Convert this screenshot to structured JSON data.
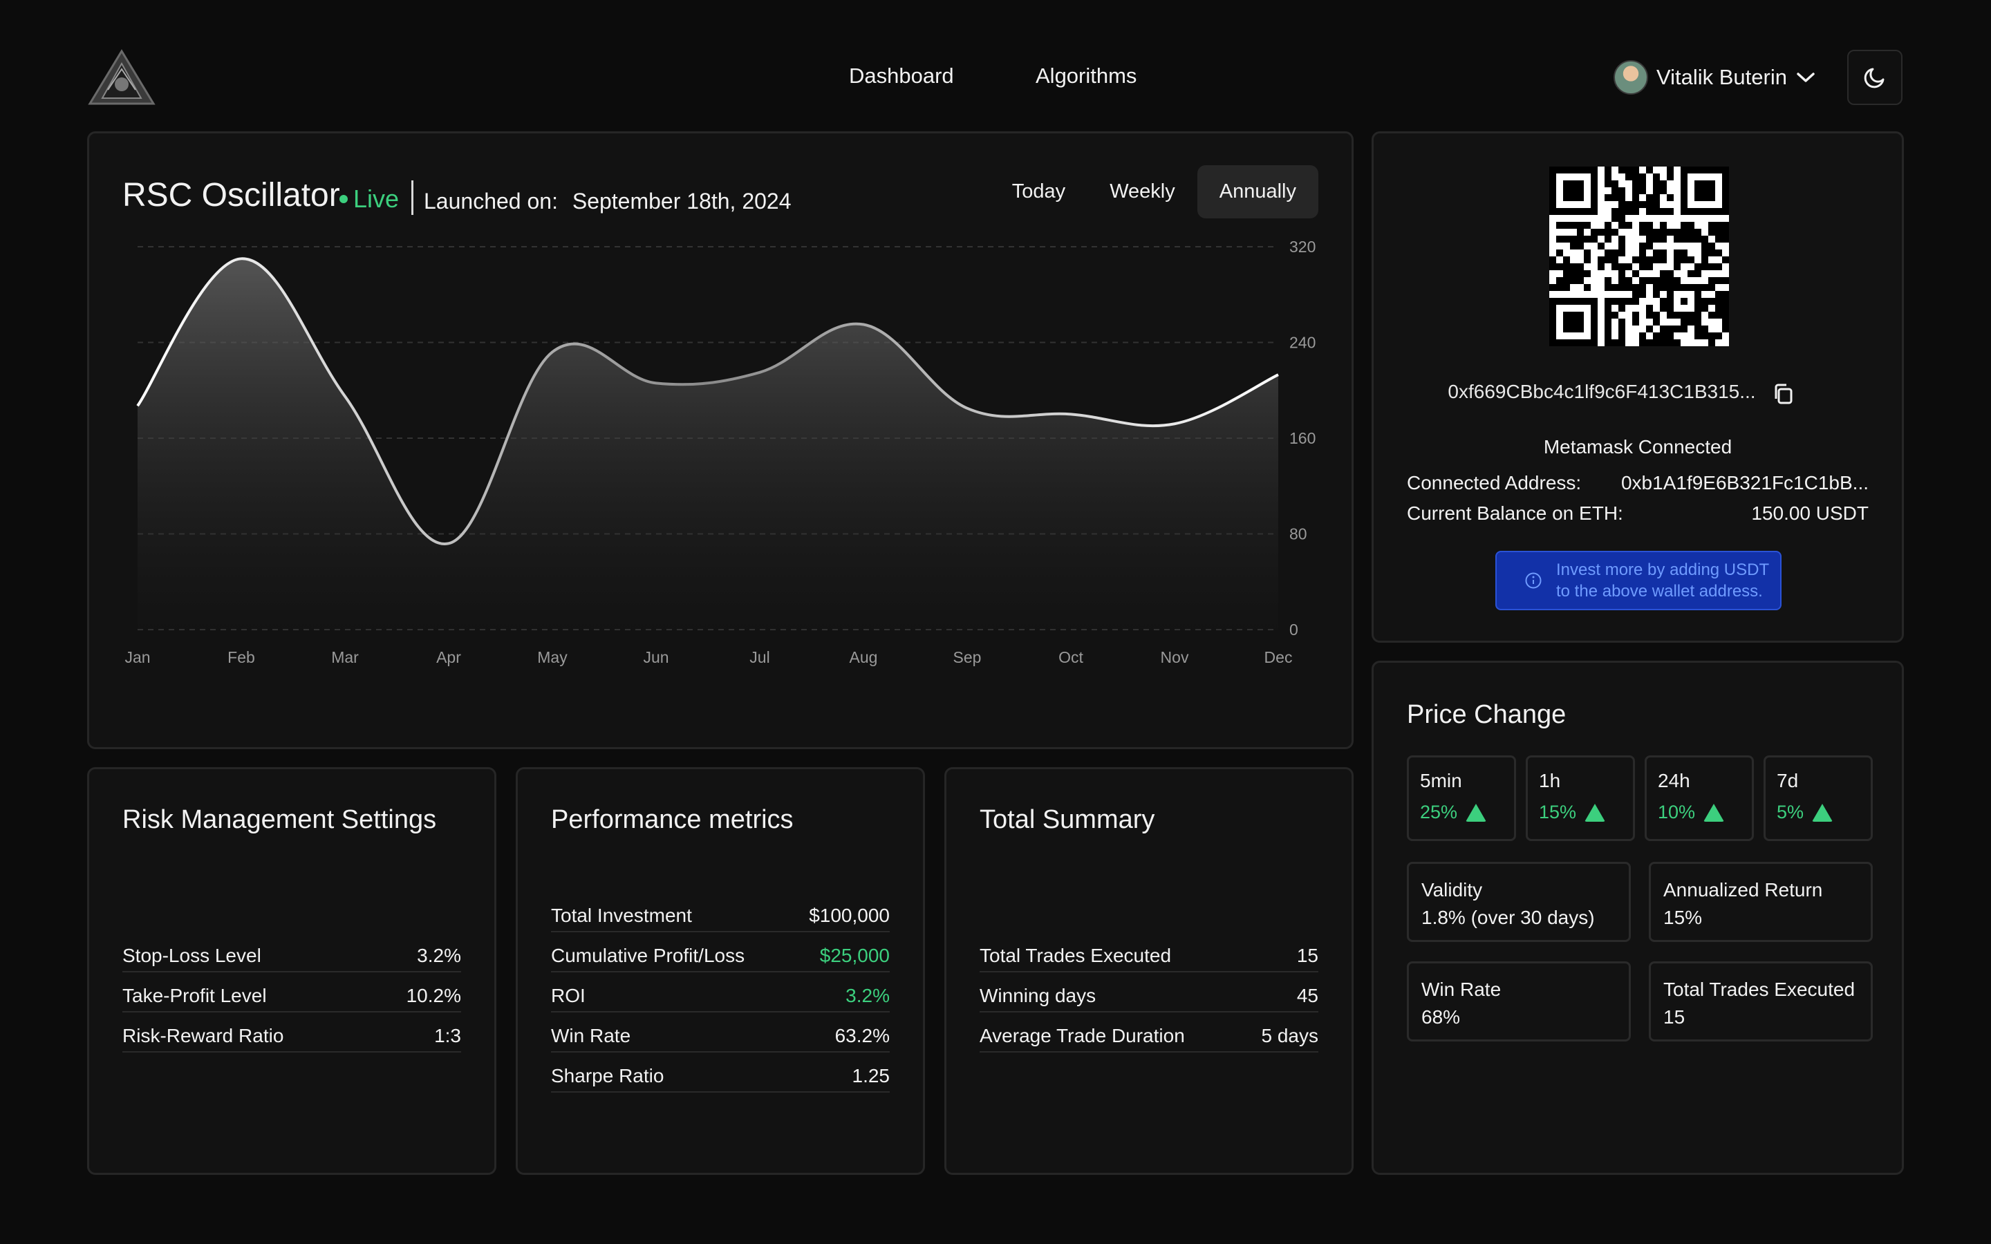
{
  "header": {
    "nav": [
      "Dashboard",
      "Algorithms"
    ],
    "user_name": "Vitalik Buterin"
  },
  "strategy": {
    "title": "RSC Oscillator",
    "status": "Live",
    "launched_label": "Launched on:",
    "launched_date": "September 18th, 2024",
    "periods": [
      "Today",
      "Weekly",
      "Annually"
    ],
    "active_period": "Annually"
  },
  "chart_data": {
    "type": "area",
    "categories": [
      "Jan",
      "Feb",
      "Mar",
      "Apr",
      "May",
      "Jun",
      "Jul",
      "Aug",
      "Sep",
      "Oct",
      "Nov",
      "Dec"
    ],
    "values": [
      187,
      310,
      195,
      72,
      232,
      206,
      215,
      255,
      185,
      180,
      172,
      213
    ],
    "y_ticks": [
      0,
      80,
      160,
      240,
      320
    ],
    "ylim": [
      0,
      320
    ],
    "grid": true
  },
  "wallet": {
    "address": "0xf669CBbc4c1lf9c6F413C1B315...",
    "status": "Metamask Connected",
    "connected_label": "Connected Address:",
    "connected_value": "0xb1A1f9E6B321Fc1C1bB...",
    "balance_label": "Current Balance on ETH:",
    "balance_value": "150.00 USDT",
    "info_line1": "Invest more by adding USDT",
    "info_line2": "to the above wallet address."
  },
  "risk": {
    "title": "Risk Management Settings",
    "rows": [
      {
        "label": "Stop-Loss Level",
        "value": "3.2%"
      },
      {
        "label": "Take-Profit Level",
        "value": "10.2%"
      },
      {
        "label": "Risk-Reward Ratio",
        "value": "1:3"
      }
    ]
  },
  "performance": {
    "title": "Performance metrics",
    "rows": [
      {
        "label": "Total Investment",
        "value": "$100,000"
      },
      {
        "label": "Cumulative Profit/Loss",
        "value": "$25,000"
      },
      {
        "label": "ROI",
        "value": "3.2%"
      },
      {
        "label": "Win Rate",
        "value": "63.2%"
      },
      {
        "label": "Sharpe Ratio",
        "value": "1.25"
      }
    ]
  },
  "summary": {
    "title": "Total Summary",
    "rows": [
      {
        "label": "Total Trades Executed",
        "value": "15"
      },
      {
        "label": "Winning days",
        "value": "45"
      },
      {
        "label": "Average Trade Duration",
        "value": "5 days"
      }
    ]
  },
  "price_change": {
    "title": "Price Change",
    "items": [
      {
        "label": "5min",
        "value": "25%"
      },
      {
        "label": "1h",
        "value": "15%"
      },
      {
        "label": "24h",
        "value": "10%"
      },
      {
        "label": "7d",
        "value": "5%"
      }
    ],
    "stats": [
      {
        "label": "Validity",
        "value": "1.8% (over 30 days)"
      },
      {
        "label": "Annualized Return",
        "value": "15%"
      },
      {
        "label": "Win Rate",
        "value": "68%"
      },
      {
        "label": "Total Trades Executed",
        "value": "15"
      }
    ]
  },
  "colors": {
    "accent_green": "#3ccf7e",
    "info_blue": "#1231a8",
    "background": "#0c0c0c"
  }
}
